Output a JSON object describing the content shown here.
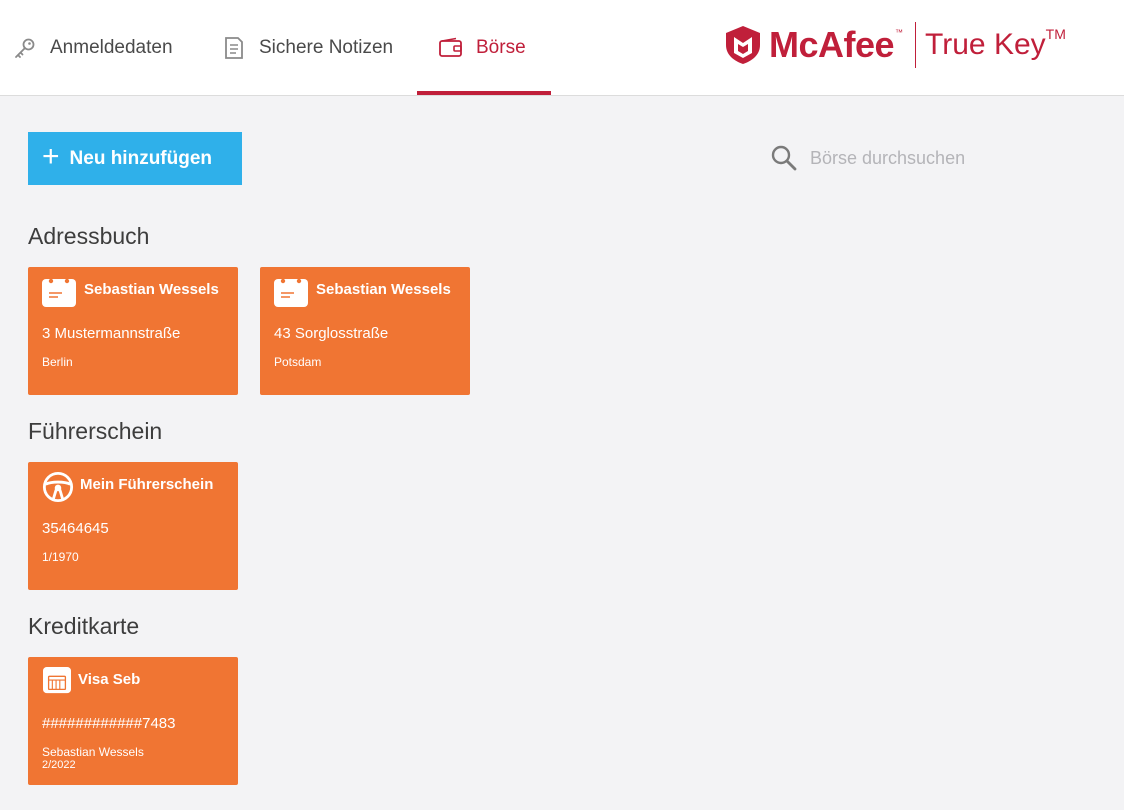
{
  "tabs": [
    {
      "label": "Anmeldedaten",
      "icon": "key-icon",
      "active": false
    },
    {
      "label": "Sichere Notizen",
      "icon": "note-icon",
      "active": false
    },
    {
      "label": "Börse",
      "icon": "wallet-icon",
      "active": true
    }
  ],
  "brand": {
    "name": "McAfee",
    "product": "True Key",
    "tm": "TM",
    "small_tm": "™",
    "color": "#c01f3a"
  },
  "toolbar": {
    "add_label": "Neu hinzufügen",
    "add_plus": "+",
    "search_placeholder": "Börse durchsuchen"
  },
  "sections": {
    "address": {
      "title": "Adressbuch",
      "cards": [
        {
          "title": "Sebastian Wessels",
          "line1": "3 Mustermannstraße",
          "line2": "Berlin"
        },
        {
          "title": "Sebastian Wessels",
          "line1": "43 Sorglosstraße",
          "line2": "Potsdam"
        }
      ]
    },
    "license": {
      "title": "Führerschein",
      "cards": [
        {
          "title": "Mein Führerschein",
          "line1": "35464645",
          "line2": "1/1970"
        }
      ]
    },
    "credit": {
      "title": "Kreditkarte",
      "cards": [
        {
          "title": "Visa Seb",
          "line1": "############7483",
          "line2": "Sebastian Wessels",
          "line3": "2/2022"
        }
      ]
    }
  },
  "colors": {
    "accent": "#c01f3a",
    "card": "#f07533",
    "button": "#2fb0ea",
    "background": "#f3f3f5"
  }
}
